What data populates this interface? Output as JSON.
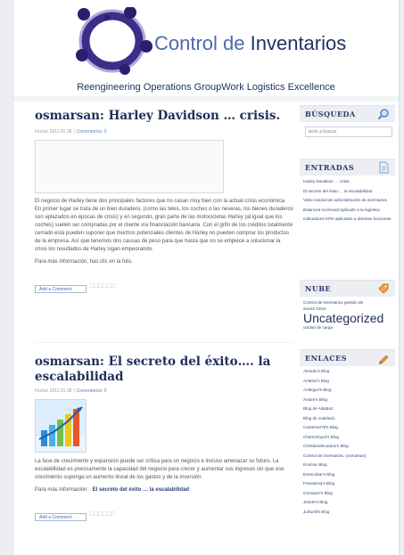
{
  "header": {
    "title_part1": "Control de ",
    "title_part2": "Inventarios",
    "tagline": "Reengineering Operations GroupWork Logistics Excellence"
  },
  "posts": [
    {
      "title": "osmarsan: Harley Davidson … crisis.",
      "meta_date": "Fecha: 2011.01.18",
      "meta_comments": "Comentarios: 0",
      "body": "El negocio de Harley tiene dos principales factores que no casan muy bien con la actual crisis económica. En primer lugar se trata de un bien duradero, (como las teles, los coches o las neveras, los bienes duraderos son aplazados en épocas de crisis) y en segundo, gran parte de las motocicletas Harley (al igual que los coches) suelen ser compradas por el cliente vía financiación bancaria. Con el grifo de los créditos totalmente cerrado está pueden suponer que muchos potenciales clientes de Harley no pueden comprar los productos de la empresa. Así que tenemos dos causas de peso para que hasta que no se empiece a solucionar la crisis los resultados de Harley sigan empeorando.",
      "more": "Para más información, has clic en la foto.",
      "comment_label": "Add a Comment"
    },
    {
      "title": "osmarsan: El secreto del éxito…. la escalabilidad",
      "meta_date": "Fecha: 2011.01.18",
      "meta_comments": "Comentarios: 0",
      "body": "La fase de crecimiento y expansión puede ser crítica para un negocio e incluso amenazar su futuro. La escalabilidad es precisamente la capacidad del negocio para crecer y aumentar sus ingresos sin que ese crecimiento suponga un aumento lineal de los gastos y de la inversión.",
      "more_prefix": "Para más información:",
      "more_link": "El secreto del éxito … la escalabilidad",
      "comment_label": "Add a Comment"
    }
  ],
  "sidebar": {
    "search": {
      "title": "BÚSQUEDA",
      "placeholder": "texto a buscar"
    },
    "entradas": {
      "title": "ENTRADAS",
      "items": [
        "Harley Davidson … crisis.",
        "El secreto del éxito…. la escalabilidad",
        "Video tutorial de administración de inventarios",
        "Balanced scorecard aplicado a la logística",
        "Indicadores KPIs aplicados a distintas funciones"
      ]
    },
    "nube": {
      "title": "NUBE",
      "line1": "Control de inventarios   gestión de",
      "line2": "stocks   Otros",
      "big": "Uncategorized",
      "small": "unidad de carga"
    },
    "enlaces": {
      "title": "ENLACES",
      "items": [
        "Almedu's Blog",
        "Antelos's Blog",
        "Antleguz's Blog",
        "Anaen's Blog",
        "Blog de Aldaba1",
        "Blog de Joaldad1",
        "Cantemar79's Blog",
        "Chamorloyar's Blog",
        "Christiandecarpos's Blog",
        "Control de inventarios. (osmarsan)",
        "Enomar Blog",
        "Esescobar's Blog",
        "Fresasmoj's Blog",
        "Gonsaurr's Blog",
        "Jstorte's Blog",
        "Jurfuelli's Blog"
      ]
    }
  },
  "colors": {
    "accent": "#4a69b0",
    "title": "#1f2d5a",
    "icon_orange": "#e8962c"
  }
}
